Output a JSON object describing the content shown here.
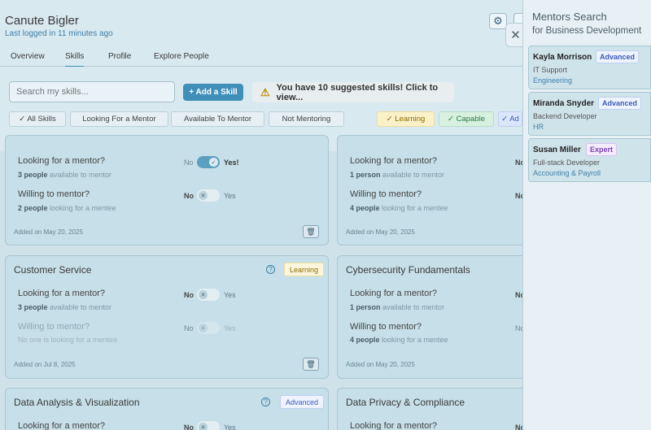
{
  "header": {
    "user_name": "Canute Bigler",
    "last_logged": "Last logged in 11 minutes ago"
  },
  "tabs": [
    "Overview",
    "Skills",
    "Profile",
    "Explore People"
  ],
  "toolbar": {
    "search_placeholder": "Search my skills...",
    "add_skill_label": "+ Add a Skill",
    "suggest_text": "You have 10 suggested skills! Click to view..."
  },
  "filters": {
    "all_skills": "✓ All Skills",
    "looking": "Looking For a Mentor",
    "available": "Available To Mentor",
    "not_mentoring": "Not Mentoring",
    "learning": "✓ Learning",
    "capable": "✓ Capable",
    "advanced_partial": "✓ Ad"
  },
  "labels": {
    "looking_q": "Looking for a mentor?",
    "willing_q": "Willing to mentor?",
    "no": "No",
    "yes": "Yes",
    "yes_on": "Yes!"
  },
  "cards": [
    {
      "title": "",
      "level": "",
      "looking_count": "3 people",
      "looking_suffix": " available to mentor",
      "willing_count": "2 people",
      "willing_suffix": " looking for a mentee",
      "added": "Added on May 20, 2025"
    },
    {
      "title": "",
      "level": "",
      "looking_count": "1 person",
      "looking_suffix": " available to mentor",
      "willing_count": "4 people",
      "willing_suffix": " looking for a mentee",
      "added": "Added on May 20, 2025"
    },
    {
      "title": "Customer Service",
      "level": "Learning",
      "looking_count": "3 people",
      "looking_suffix": " available to mentor",
      "willing_note": "No one is looking for a mentee",
      "added": "Added on Jul 8, 2025"
    },
    {
      "title": "Cybersecurity Fundamentals",
      "level": "",
      "looking_count": "1 person",
      "looking_suffix": " available to mentor",
      "willing_count": "4 people",
      "willing_suffix": " looking for a mentee",
      "added": "Added on May 20, 2025"
    },
    {
      "title": "Data Analysis & Visualization",
      "level": "Advanced"
    },
    {
      "title": "Data Privacy & Compliance",
      "level": ""
    }
  ],
  "panel": {
    "title": "Mentors Search",
    "subtitle": "for Business Development",
    "mentors": [
      {
        "name": "Kayla Morrison",
        "level": "Advanced",
        "role": "IT Support",
        "dept": "Engineering"
      },
      {
        "name": "Miranda Snyder",
        "level": "Advanced",
        "role": "Backend Developer",
        "dept": "HR"
      },
      {
        "name": "Susan Miller",
        "level": "Expert",
        "role": "Full-stack Developer",
        "dept": "Accounting & Payroll"
      }
    ]
  },
  "icons": {
    "gear": "gear-icon",
    "close": "close-icon",
    "warning": "warning-icon",
    "help": "help-icon",
    "trash": "trash-icon"
  },
  "colors": {
    "accent": "#3f8fb8",
    "learning": "#8a6d00",
    "capable": "#2e7a47",
    "advanced": "#3d5bb7",
    "expert": "#7b3fb8"
  }
}
